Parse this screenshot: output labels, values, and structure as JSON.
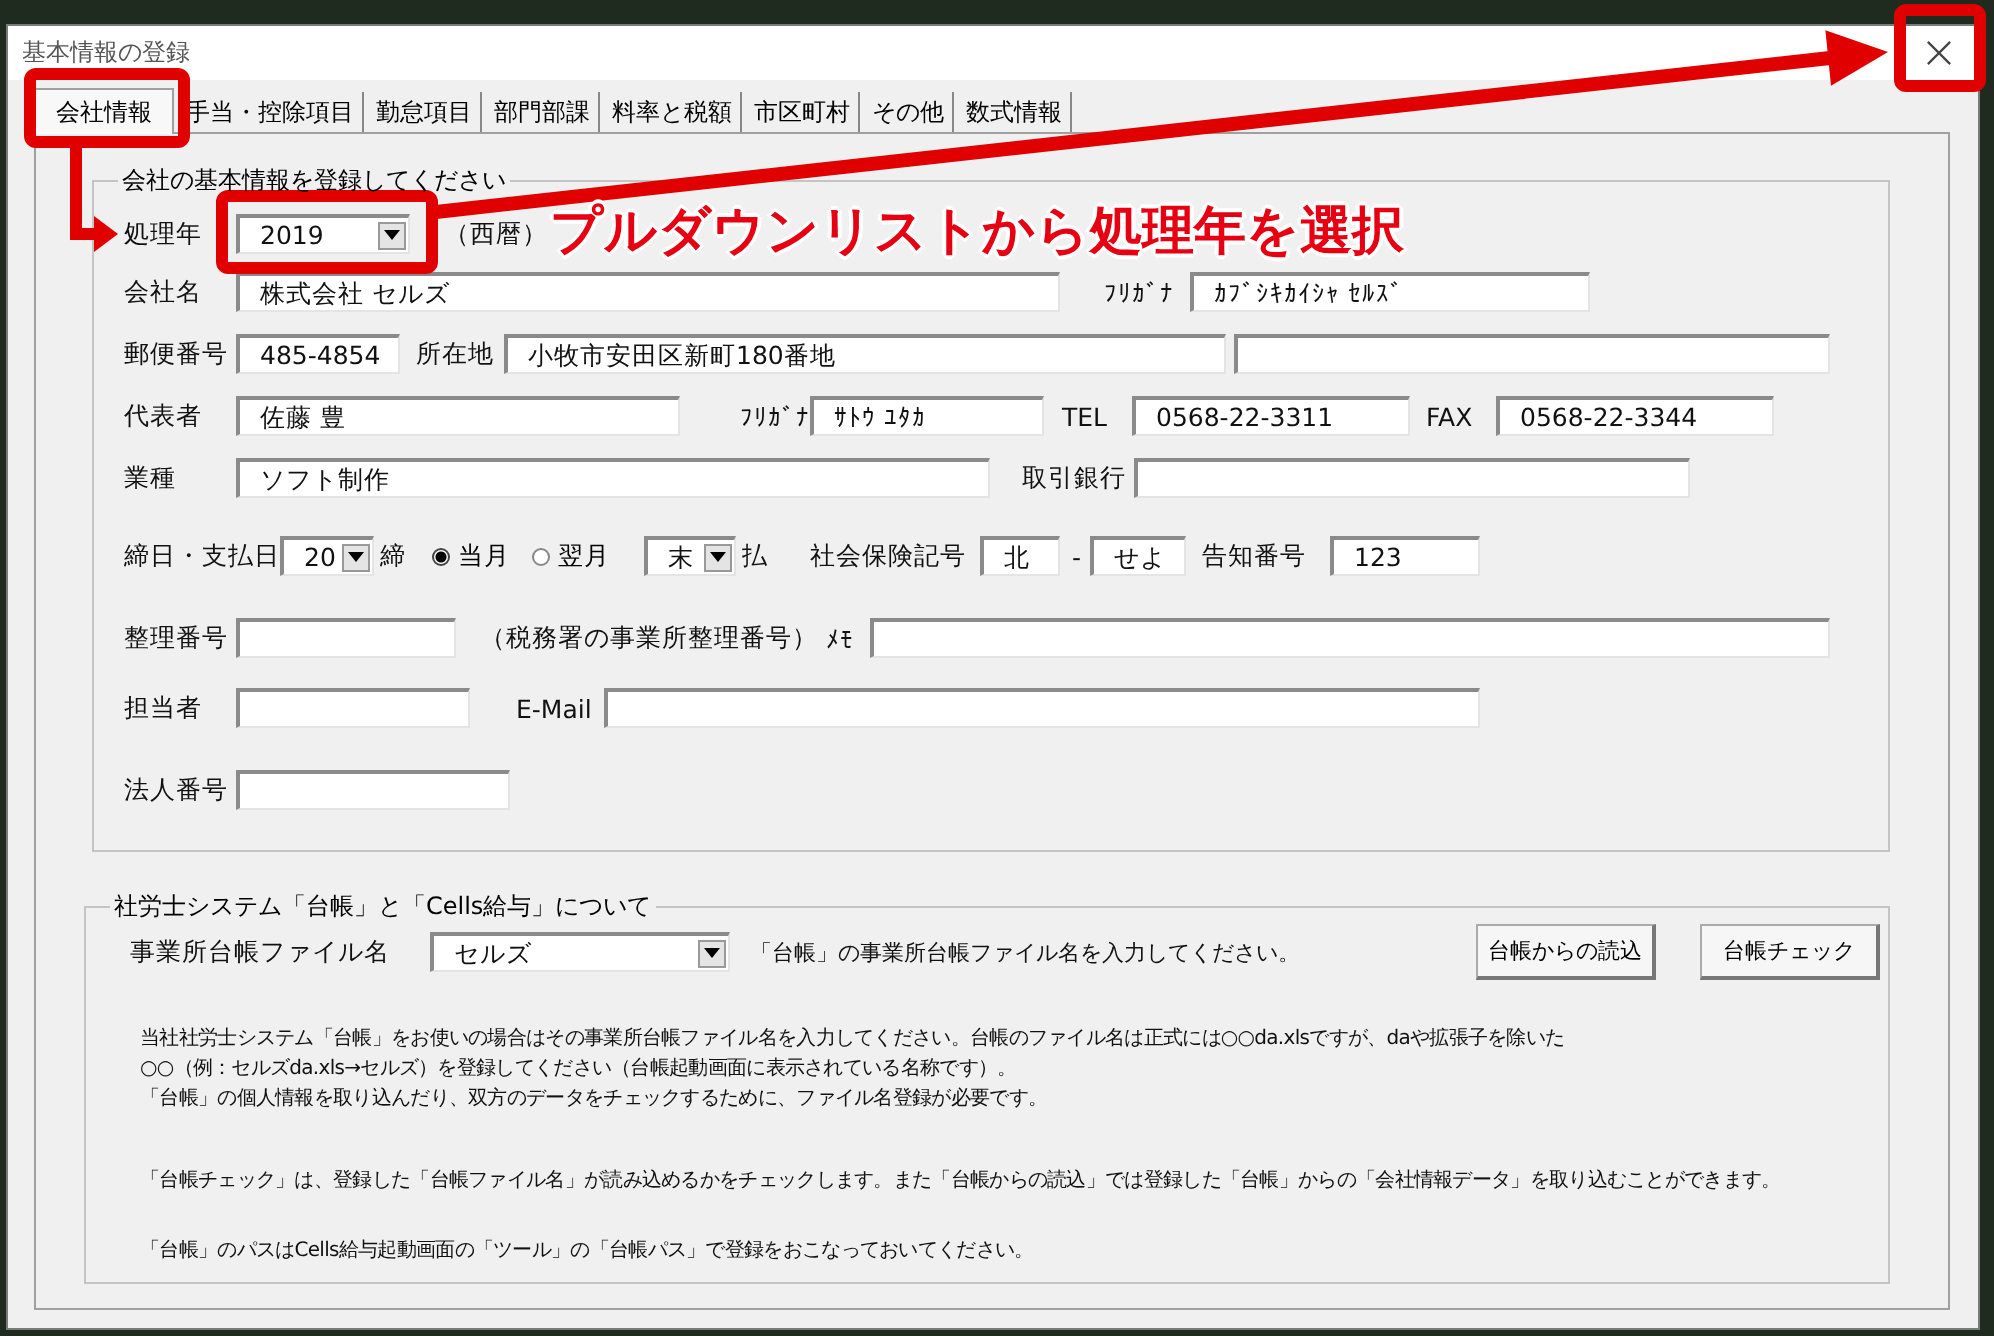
{
  "window": {
    "title": "基本情報の登録"
  },
  "tabs": [
    {
      "label": "会社情報",
      "selected": true
    },
    {
      "label": "手当・控除項目",
      "selected": false
    },
    {
      "label": "勤怠項目",
      "selected": false
    },
    {
      "label": "部門部課",
      "selected": false
    },
    {
      "label": "料率と税額",
      "selected": false
    },
    {
      "label": "市区町村",
      "selected": false
    },
    {
      "label": "その他",
      "selected": false
    },
    {
      "label": "数式情報",
      "selected": false
    }
  ],
  "annotation": {
    "callout": "プルダウンリストから処理年を選択"
  },
  "company_info": {
    "title": "会社の基本情報を登録してください",
    "rows": [
      {
        "items": [
          {
            "kind": "label",
            "text": "処理年"
          },
          {
            "kind": "dropdown",
            "value": "2019"
          },
          {
            "kind": "label",
            "text": "（西暦）"
          }
        ]
      },
      {
        "items": [
          {
            "kind": "label",
            "text": "会社名"
          },
          {
            "kind": "field",
            "value": "株式会社 セルズ"
          },
          {
            "kind": "label",
            "text": "ﾌﾘｶﾞﾅ"
          },
          {
            "kind": "field",
            "value": "ｶﾌﾞｼｷｶｲｼｬ ｾﾙｽﾞ"
          }
        ]
      },
      {
        "items": [
          {
            "kind": "label",
            "text": "郵便番号"
          },
          {
            "kind": "field",
            "value": "485-4854"
          },
          {
            "kind": "label",
            "text": "所在地"
          },
          {
            "kind": "field",
            "value": "小牧市安田区新町180番地"
          },
          {
            "kind": "field"
          }
        ]
      },
      {
        "items": [
          {
            "kind": "label",
            "text": "代表者"
          },
          {
            "kind": "field",
            "value": "佐藤 豊"
          },
          {
            "kind": "label",
            "text": "ﾌﾘｶﾞﾅ"
          },
          {
            "kind": "field",
            "value": "ｻﾄｳ ﾕﾀｶ"
          },
          {
            "kind": "label",
            "text": "TEL"
          },
          {
            "kind": "field",
            "value": "0568-22-3311"
          },
          {
            "kind": "label",
            "text": "FAX"
          },
          {
            "kind": "field",
            "value": "0568-22-3344"
          }
        ]
      },
      {
        "items": [
          {
            "kind": "label",
            "text": "業種"
          },
          {
            "kind": "field",
            "value": "ソフト制作"
          },
          {
            "kind": "label",
            "text": "取引銀行"
          },
          {
            "kind": "field"
          }
        ]
      },
      {
        "items": [
          {
            "kind": "label",
            "text": "締日・支払日"
          },
          {
            "kind": "dropdown",
            "value": "20"
          },
          {
            "kind": "label",
            "text": "締"
          },
          {
            "kind": "radio",
            "text": "当月",
            "selected": true
          },
          {
            "kind": "radio",
            "text": "翌月",
            "selected": false
          },
          {
            "kind": "dropdown",
            "value": "末"
          },
          {
            "kind": "label",
            "text": "払"
          },
          {
            "kind": "label",
            "text": "社会保険記号"
          },
          {
            "kind": "field",
            "value": "北"
          },
          {
            "kind": "label",
            "text": "-"
          },
          {
            "kind": "field",
            "value": "せよ"
          },
          {
            "kind": "label",
            "text": "告知番号"
          },
          {
            "kind": "field",
            "value": "123"
          }
        ]
      },
      {
        "items": [
          {
            "kind": "label",
            "text": "整理番号"
          },
          {
            "kind": "field"
          },
          {
            "kind": "label",
            "text": "（税務署の事業所整理番号）"
          },
          {
            "kind": "label",
            "text": "ﾒﾓ"
          },
          {
            "kind": "field"
          }
        ]
      },
      {
        "items": [
          {
            "kind": "label",
            "text": "担当者"
          },
          {
            "kind": "field"
          },
          {
            "kind": "label",
            "text": "E-Mail"
          },
          {
            "kind": "field"
          }
        ]
      },
      {
        "items": [
          {
            "kind": "label",
            "text": "法人番号"
          },
          {
            "kind": "field"
          }
        ]
      }
    ]
  },
  "ledger": {
    "title": "社労士システム「台帳」と「Cells給与」について",
    "file_label": "事業所台帳ファイル名",
    "file_value": "セルズ",
    "file_hint": "「台帳」の事業所台帳ファイル名を入力してください。",
    "buttons": [
      "台帳からの読込",
      "台帳チェック"
    ],
    "notes": [
      [
        "当社社労士システム「台帳」をお使いの場合はその事業所台帳ファイル名を入力してください。台帳のファイル名は正式には○○da.xlsですが、daや拡張子を除いた",
        "○○（例：セルズda.xls→セルズ）を登録してください（台帳起動画面に表示されている名称です）。",
        "「台帳」の個人情報を取り込んだり、双方のデータをチェックするために、ファイル名登録が必要です。"
      ],
      [
        "「台帳チェック」は、登録した「台帳ファイル名」が読み込めるかをチェックします。また「台帳からの読込」では登録した「台帳」からの「会社情報データ」を取り込むことができます。"
      ],
      [
        "「台帳」のパスはCells給与起動画面の「ツール」の「台帳パス」で登録をおこなっておいてください。"
      ]
    ]
  }
}
